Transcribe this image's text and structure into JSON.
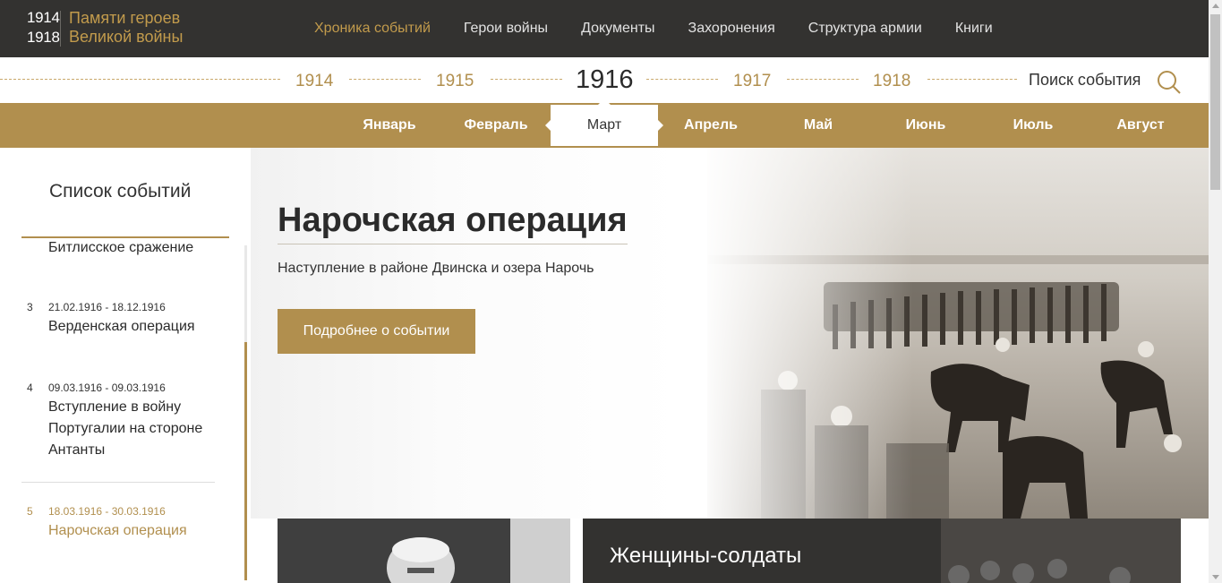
{
  "logo": {
    "year_start": "1914",
    "year_end": "1918",
    "title_line1": "Памяти героев",
    "title_line2": "Великой войны"
  },
  "nav": [
    {
      "label": "Хроника событий",
      "active": true
    },
    {
      "label": "Герои войны"
    },
    {
      "label": "Документы"
    },
    {
      "label": "Захоронения"
    },
    {
      "label": "Структура армии"
    },
    {
      "label": "Книги"
    }
  ],
  "years": [
    "1914",
    "1915",
    "1916",
    "1917",
    "1918"
  ],
  "current_year": "1916",
  "search": {
    "label": "Поиск события"
  },
  "months": [
    "Январь",
    "Февраль",
    "Март",
    "Апрель",
    "Май",
    "Июнь",
    "Июль",
    "Август"
  ],
  "active_month": "Март",
  "sidebar": {
    "title": "Список событий",
    "events": [
      {
        "num": "",
        "date": "",
        "title": "Битлисское сражение"
      },
      {
        "num": "3",
        "date": "21.02.1916 - 18.12.1916",
        "title": "Верденская операция"
      },
      {
        "num": "4",
        "date": "09.03.1916 - 09.03.1916",
        "title": "Вступление в войну Португалии на стороне Антанты"
      },
      {
        "num": "5",
        "date": "18.03.1916 - 30.03.1916",
        "title": "Нарочская операция",
        "active": true
      }
    ]
  },
  "hero": {
    "title": "Нарочская операция",
    "subtitle": "Наступление в районе Двинска и озера Нарочь",
    "button": "Подробнее о событии"
  },
  "cards": {
    "card2_title": "Женщины-солдаты"
  },
  "colors": {
    "accent": "#b18f4e",
    "header_bg": "#333230"
  }
}
